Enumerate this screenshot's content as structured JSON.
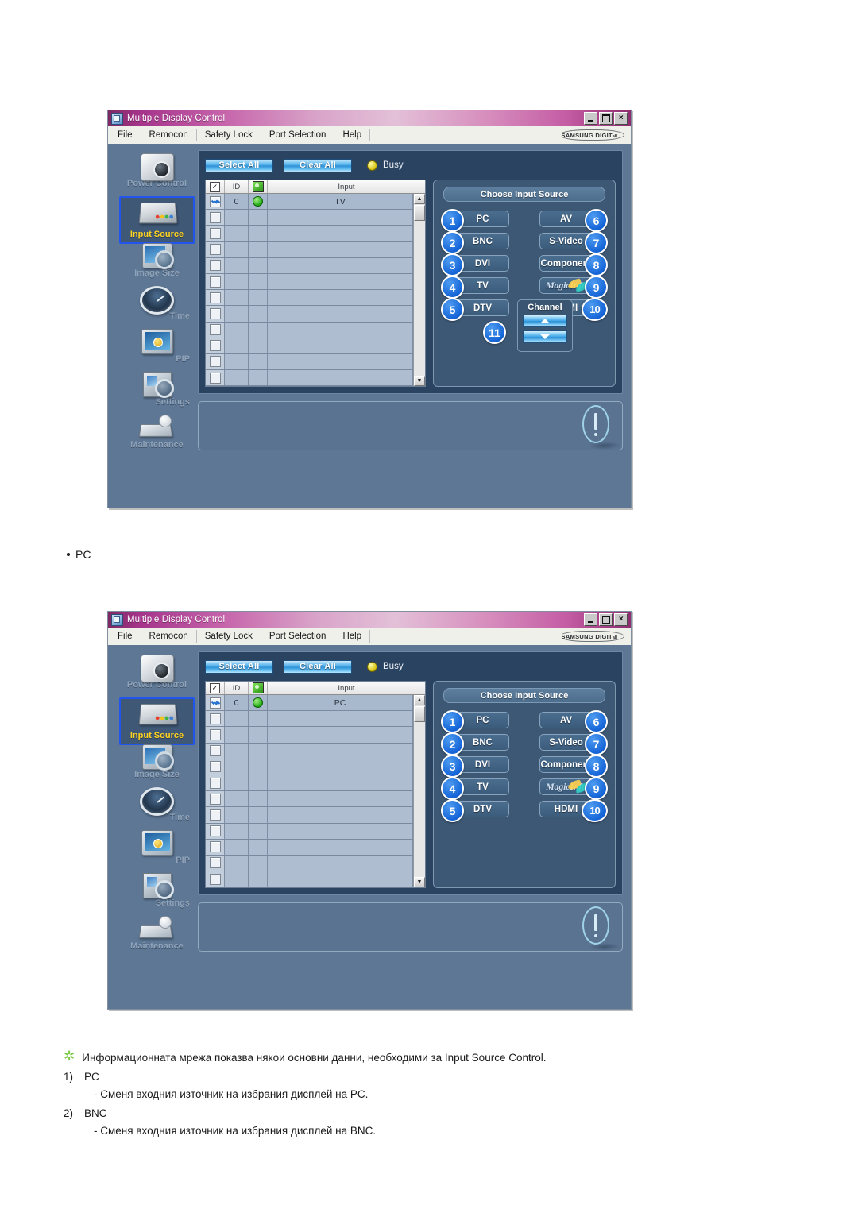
{
  "window": {
    "title": "Multiple Display Control",
    "controls": {
      "minimize": "_",
      "maximize": "□",
      "close": "×"
    },
    "menu": [
      "File",
      "Remocon",
      "Safety Lock",
      "Port Selection",
      "Help"
    ],
    "brand": "SAMSUNG DIGIT",
    "brand_tail": "all"
  },
  "sidebar": {
    "items": [
      {
        "label": "Power Control",
        "icon": "power-control-icon",
        "active": false
      },
      {
        "label": "Input Source",
        "icon": "input-source-icon",
        "active": true
      },
      {
        "label": "Image Size",
        "icon": "image-size-icon",
        "active": false
      },
      {
        "label": "Time",
        "icon": "time-icon",
        "active": false
      },
      {
        "label": "PIP",
        "icon": "pip-icon",
        "active": false
      },
      {
        "label": "Settings",
        "icon": "settings-icon",
        "active": false
      },
      {
        "label": "Maintenance",
        "icon": "maintenance-icon",
        "active": false
      }
    ]
  },
  "toolbar": {
    "select_all": "Select All",
    "clear_all": "Clear All",
    "busy_label": "Busy",
    "busy_led_color": "#d8c613"
  },
  "table": {
    "headers": {
      "check": "☑",
      "id": "ID",
      "status": "status-icon",
      "input": "Input"
    },
    "rows_win1": [
      {
        "checked": true,
        "id": "0",
        "status": "online",
        "input": "TV"
      }
    ],
    "rows_win2": [
      {
        "checked": true,
        "id": "0",
        "status": "online",
        "input": "PC"
      }
    ],
    "empty_row_count": 11,
    "scroll_up": "▲",
    "scroll_down": "▼"
  },
  "input_source": {
    "title": "Choose Input Source",
    "buttons": [
      {
        "n": "1",
        "label": "PC",
        "side": "left"
      },
      {
        "n": "6",
        "label": "AV",
        "side": "right"
      },
      {
        "n": "2",
        "label": "BNC",
        "side": "left"
      },
      {
        "n": "7",
        "label": "S-Video",
        "side": "right"
      },
      {
        "n": "3",
        "label": "DVI",
        "side": "left"
      },
      {
        "n": "8",
        "label": "Component",
        "side": "right"
      },
      {
        "n": "4",
        "label": "TV",
        "side": "left"
      },
      {
        "n": "9",
        "label": "MagicInfo",
        "side": "right"
      },
      {
        "n": "5",
        "label": "DTV",
        "side": "left"
      },
      {
        "n": "10",
        "label": "HDMI",
        "side": "right"
      }
    ],
    "channel": {
      "number": "11",
      "title": "Channel",
      "up": "▲",
      "down": "▼"
    }
  },
  "page": {
    "bullet_pc": "PC",
    "note_intro": "Информационната мрежа показва някои основни данни, необходими за Input Source Control.",
    "items": [
      {
        "num": "1)",
        "label": "PC",
        "desc": "- Сменя входния източник на избрания дисплей на PC."
      },
      {
        "num": "2)",
        "label": "BNC",
        "desc": "- Сменя входния източник на избрания дисплей на BNC."
      }
    ]
  },
  "colors": {
    "window_bg": "#5d7795",
    "panel_dark": "#2a4361",
    "accent_blue": "#1565d8",
    "active_label": "#ffd21e",
    "star_green": "#7ac943"
  }
}
